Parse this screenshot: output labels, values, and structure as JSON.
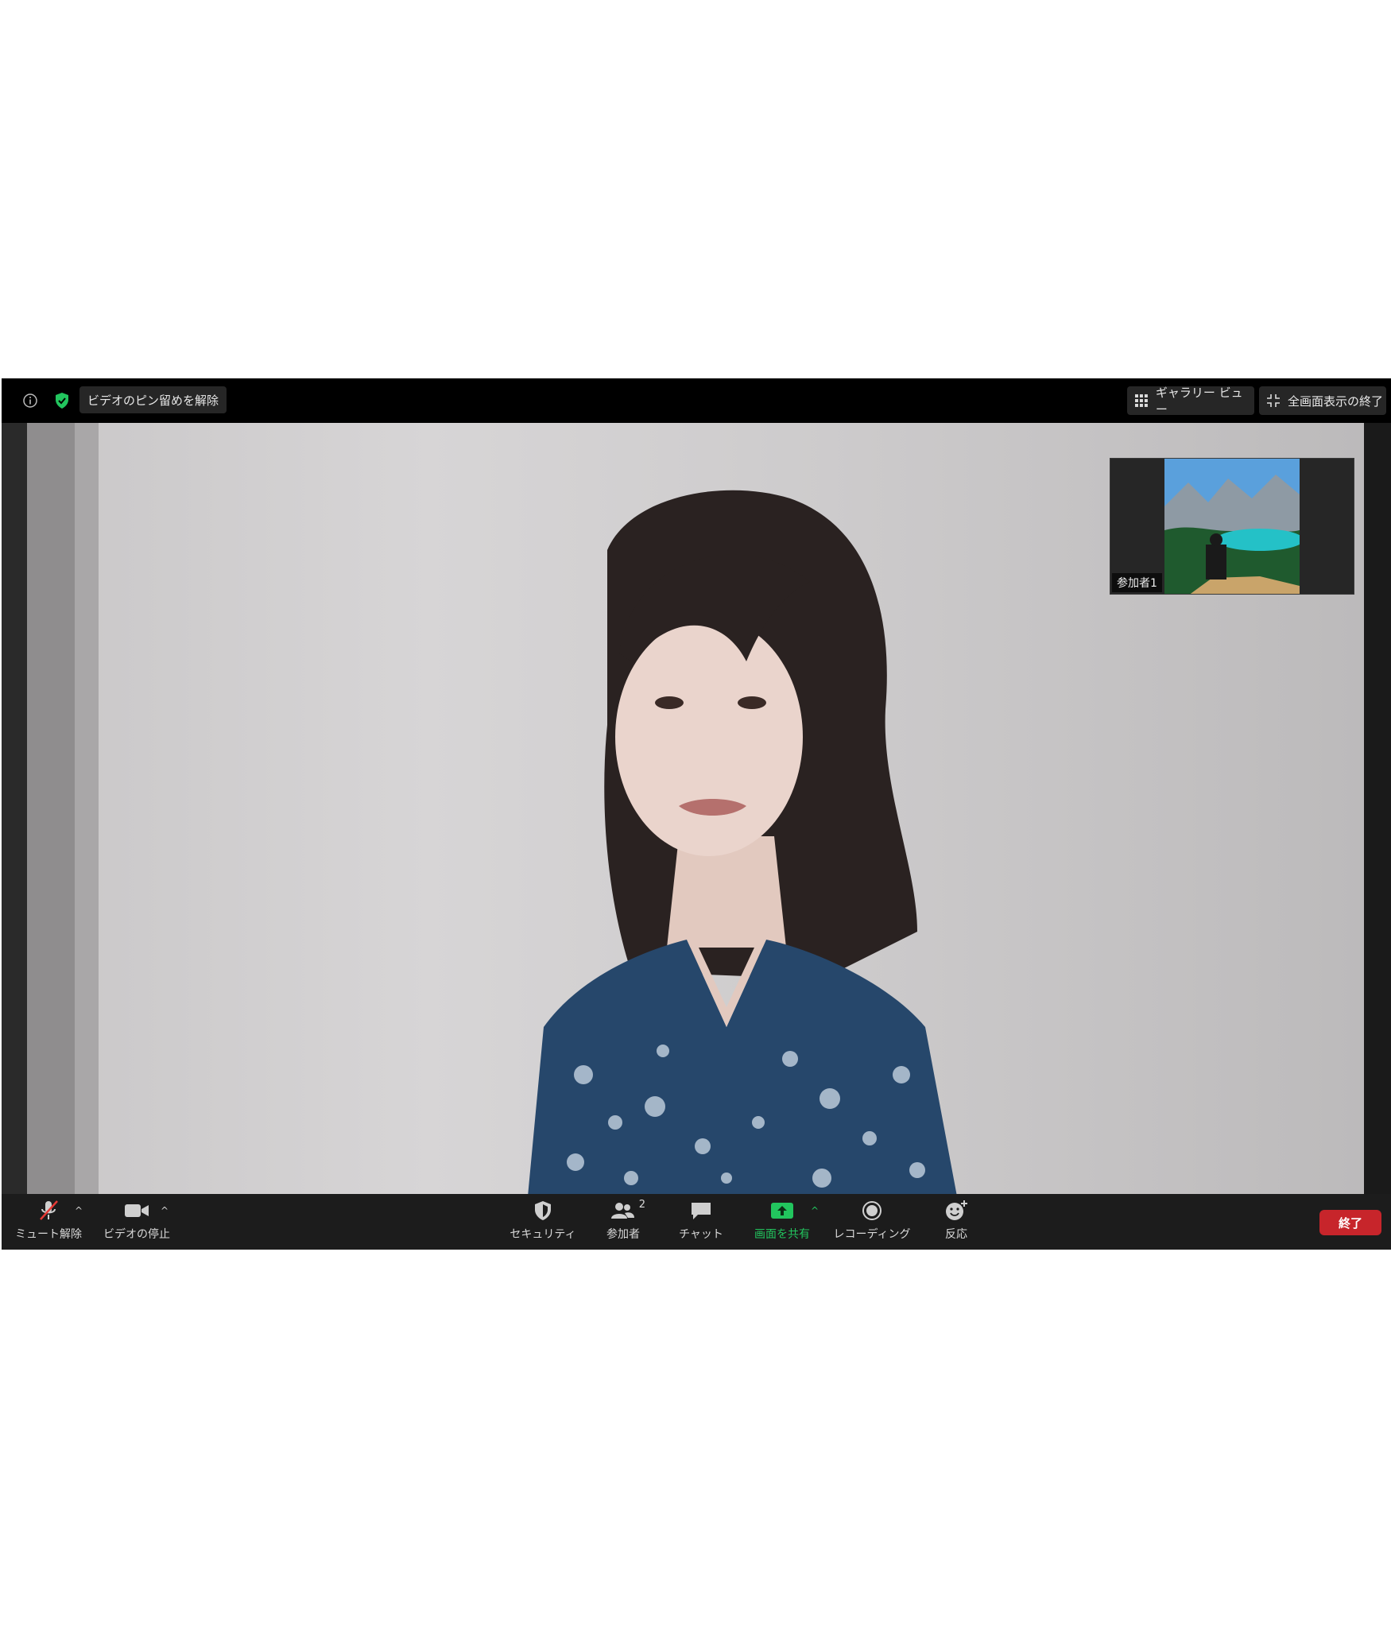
{
  "top_bar": {
    "info_icon": "info-icon",
    "security_shield_icon": "shield-check-icon",
    "unpin_label": "ビデオのピン留めを解除",
    "gallery_label": "ギャラリー ビュー",
    "exit_fullscreen_label": "全画面表示の終了"
  },
  "thumbnail": {
    "participant_name": "参加者1"
  },
  "toolbar": {
    "unmute_label": "ミュート解除",
    "stop_video_label": "ビデオの停止",
    "security_label": "セキュリティ",
    "participants_label": "参加者",
    "participants_count": "2",
    "chat_label": "チャット",
    "share_label": "画面を共有",
    "record_label": "レコーディング",
    "reactions_label": "反応",
    "end_label": "終了"
  },
  "colors": {
    "share_green": "#22c55e",
    "end_red": "#c7252b",
    "toolbar_bg": "#1c1c1c"
  }
}
